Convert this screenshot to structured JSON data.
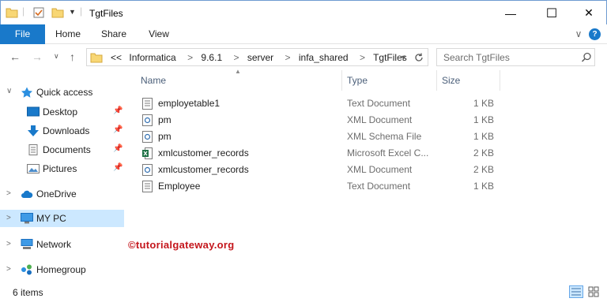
{
  "window": {
    "title": "TgtFiles",
    "minimize": "—",
    "maximize": "☐",
    "close": "✕"
  },
  "ribbon": {
    "tabs": [
      "File",
      "Home",
      "Share",
      "View"
    ],
    "expand": "∨",
    "help": "?"
  },
  "nav": {
    "back": "←",
    "forward": "→",
    "recent": "∨",
    "up": "↑"
  },
  "address": {
    "overflow": "<<",
    "crumbs": [
      "Informatica",
      "9.6.1",
      "server",
      "infa_shared",
      "TgtFiles"
    ],
    "separator": ">"
  },
  "search": {
    "placeholder": "Search TgtFiles"
  },
  "sidebar": {
    "items": [
      {
        "label": "Quick access",
        "icon": "star-icon"
      },
      {
        "label": "Desktop",
        "icon": "desktop-icon"
      },
      {
        "label": "Downloads",
        "icon": "download-icon"
      },
      {
        "label": "Documents",
        "icon": "documents-icon"
      },
      {
        "label": "Pictures",
        "icon": "pictures-icon"
      },
      {
        "label": "OneDrive",
        "icon": "cloud-icon"
      },
      {
        "label": "MY PC",
        "icon": "computer-icon"
      },
      {
        "label": "Network",
        "icon": "network-icon"
      },
      {
        "label": "Homegroup",
        "icon": "homegroup-icon"
      }
    ]
  },
  "columns": {
    "name": "Name",
    "type": "Type",
    "size": "Size"
  },
  "files": [
    {
      "name": "employetable1",
      "type": "Text Document",
      "size": "1 KB",
      "icon": "text-file-icon"
    },
    {
      "name": "pm",
      "type": "XML Document",
      "size": "1 KB",
      "icon": "xml-file-icon"
    },
    {
      "name": "pm",
      "type": "XML Schema File",
      "size": "1 KB",
      "icon": "xml-file-icon"
    },
    {
      "name": "xmlcustomer_records",
      "type": "Microsoft Excel C...",
      "size": "2 KB",
      "icon": "excel-file-icon"
    },
    {
      "name": "xmlcustomer_records",
      "type": "XML Document",
      "size": "2 KB",
      "icon": "xml-file-icon"
    },
    {
      "name": "Employee",
      "type": "Text Document",
      "size": "1 KB",
      "icon": "text-file-icon"
    }
  ],
  "watermark": "©tutorialgateway.org",
  "status": {
    "count": "6 items"
  },
  "colors": {
    "accent": "#1979ca",
    "selection": "#cce8ff",
    "watermark": "#c4161c"
  }
}
